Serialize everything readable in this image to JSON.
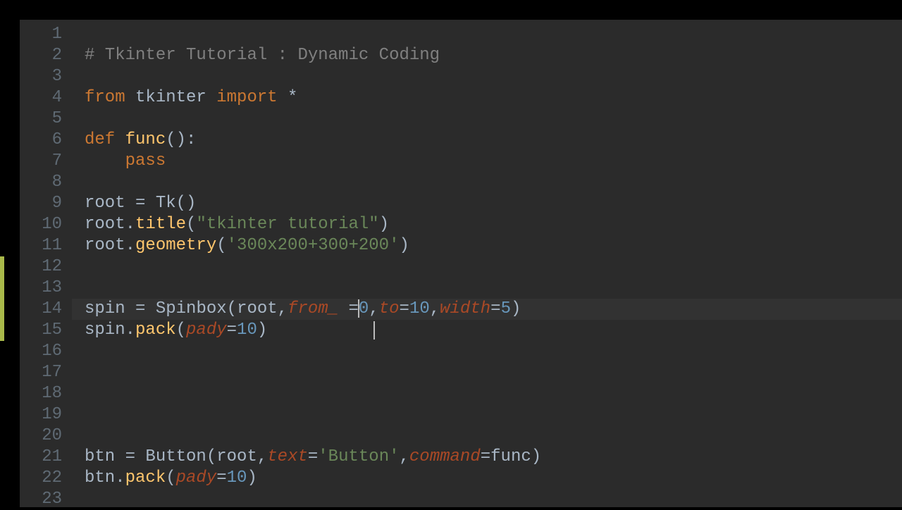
{
  "editor": {
    "line_numbers": [
      "1",
      "2",
      "3",
      "4",
      "5",
      "6",
      "7",
      "8",
      "9",
      "10",
      "11",
      "12",
      "13",
      "14",
      "15",
      "16",
      "17",
      "18",
      "19",
      "20",
      "21",
      "22",
      "23"
    ],
    "highlighted_line_index": 13,
    "change_bar": {
      "start_index": 11,
      "end_index": 14
    },
    "tokens": {
      "l2_comment": "# Tkinter Tutorial : Dynamic Coding",
      "l4_from": "from",
      "l4_tkinter": " tkinter ",
      "l4_import": "import",
      "l4_star": " *",
      "l6_def": "def",
      "l6_sp1": " ",
      "l6_func": "func",
      "l6_rest": "():",
      "l7_indent": "    ",
      "l7_pass": "pass",
      "l9_root": "root = ",
      "l9_tk": "Tk",
      "l9_paren": "()",
      "l10_root": "root.",
      "l10_title": "title",
      "l10_open": "(",
      "l10_str": "\"tkinter tutorial\"",
      "l10_close": ")",
      "l11_root": "root.",
      "l11_geom": "geometry",
      "l11_open": "(",
      "l11_str": "'300x200+300+200'",
      "l11_close": ")",
      "l14_spin": "spin = ",
      "l14_Spinbox": "Spinbox",
      "l14_open": "(",
      "l14_root": "root,",
      "l14_from": "from_",
      "l14_sp": " ",
      "l14_eq1": "=",
      "l14_0": "0",
      "l14_c1": ",",
      "l14_to": "to",
      "l14_eq2": "=",
      "l14_10": "10",
      "l14_c2": ",",
      "l14_width": "width",
      "l14_eq3": "=",
      "l14_5": "5",
      "l14_close": ")",
      "l15_spin": "spin.",
      "l15_pack": "pack",
      "l15_open": "(",
      "l15_pady": "pady",
      "l15_eq": "=",
      "l15_10": "10",
      "l15_close": ")",
      "l21_btn": "btn = ",
      "l21_Button": "Button",
      "l21_open": "(",
      "l21_root": "root,",
      "l21_text": "text",
      "l21_eq1": "=",
      "l21_str": "'Button'",
      "l21_c1": ",",
      "l21_command": "command",
      "l21_eq2": "=",
      "l21_func": "func",
      "l21_close": ")",
      "l22_btn": "btn.",
      "l22_pack": "pack",
      "l22_open": "(",
      "l22_pady": "pady",
      "l22_eq": "=",
      "l22_10": "10",
      "l22_close": ")"
    }
  },
  "chart_data": {
    "type": "table",
    "title": "Python source code (Tkinter tutorial)",
    "lines": [
      {
        "n": 1,
        "text": ""
      },
      {
        "n": 2,
        "text": "# Tkinter Tutorial : Dynamic Coding"
      },
      {
        "n": 3,
        "text": ""
      },
      {
        "n": 4,
        "text": "from tkinter import *"
      },
      {
        "n": 5,
        "text": ""
      },
      {
        "n": 6,
        "text": "def func():"
      },
      {
        "n": 7,
        "text": "    pass"
      },
      {
        "n": 8,
        "text": ""
      },
      {
        "n": 9,
        "text": "root = Tk()"
      },
      {
        "n": 10,
        "text": "root.title(\"tkinter tutorial\")"
      },
      {
        "n": 11,
        "text": "root.geometry('300x200+300+200')"
      },
      {
        "n": 12,
        "text": ""
      },
      {
        "n": 13,
        "text": ""
      },
      {
        "n": 14,
        "text": "spin = Spinbox(root,from_ =0,to=10,width=5)"
      },
      {
        "n": 15,
        "text": "spin.pack(pady=10)"
      },
      {
        "n": 16,
        "text": ""
      },
      {
        "n": 17,
        "text": ""
      },
      {
        "n": 18,
        "text": ""
      },
      {
        "n": 19,
        "text": ""
      },
      {
        "n": 20,
        "text": ""
      },
      {
        "n": 21,
        "text": "btn = Button(root,text='Button',command=func)"
      },
      {
        "n": 22,
        "text": "btn.pack(pady=10)"
      },
      {
        "n": 23,
        "text": ""
      }
    ]
  }
}
